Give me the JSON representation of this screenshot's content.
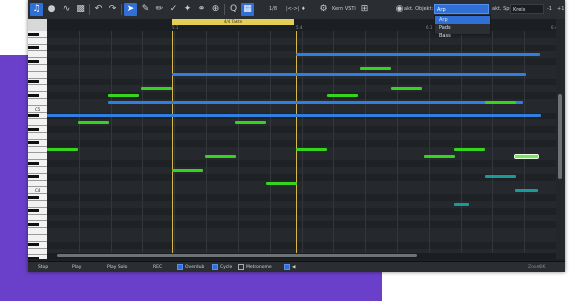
{
  "toolbar": {
    "quantize_value": "1/8",
    "ticks_label": "|<->| ♦",
    "instrument_label": "Kern VSTi",
    "object_label": "akt. Objekt:",
    "object_value": "Arp",
    "source_label": "akt. Spur:",
    "source_value": "Kreis",
    "minus_label": "-1",
    "plus_label": "+1"
  },
  "dropdown": {
    "items": [
      "Arp",
      "Pads",
      "Bass"
    ]
  },
  "ruler": {
    "region_label": "4/4 Takte",
    "markers": [
      {
        "label": "5.1",
        "pos": 0.245
      },
      {
        "label": "5.4",
        "pos": 0.49
      },
      {
        "label": "6.1",
        "pos": 0.745
      },
      {
        "label": "6.4",
        "pos": 0.99
      }
    ]
  },
  "piano": {
    "octave_labels": [
      "C5",
      "C4",
      "C3"
    ]
  },
  "notes": [
    {
      "start": 0.49,
      "length": 0.48,
      "row": 3,
      "color": "#2f7fe0"
    },
    {
      "start": 0.615,
      "length": 0.06,
      "row": 5,
      "color": "#34d41f"
    },
    {
      "start": 0.245,
      "length": 0.695,
      "row": 6,
      "color": "#2f7fe0"
    },
    {
      "start": 0.185,
      "length": 0.06,
      "row": 8,
      "color": "#34d41f"
    },
    {
      "start": 0.675,
      "length": 0.06,
      "row": 8,
      "color": "#34d41f"
    },
    {
      "start": 0.12,
      "length": 0.06,
      "row": 9,
      "color": "#34d41f"
    },
    {
      "start": 0.55,
      "length": 0.06,
      "row": 9,
      "color": "#34d41f"
    },
    {
      "start": 0.12,
      "length": 0.815,
      "row": 10,
      "color": "#2f7fe0"
    },
    {
      "start": 0.86,
      "length": 0.06,
      "row": 10,
      "color": "#34d41f"
    },
    {
      "start": 0.0,
      "length": 0.97,
      "row": 12,
      "color": "#2f7fe0"
    },
    {
      "start": 0.06,
      "length": 0.06,
      "row": 13,
      "color": "#34d41f"
    },
    {
      "start": 0.37,
      "length": 0.06,
      "row": 13,
      "color": "#34d41f"
    },
    {
      "start": 0.0,
      "length": 0.06,
      "row": 17,
      "color": "#34d41f"
    },
    {
      "start": 0.49,
      "length": 0.06,
      "row": 17,
      "color": "#34d41f"
    },
    {
      "start": 0.8,
      "length": 0.06,
      "row": 17,
      "color": "#34d41f"
    },
    {
      "start": 0.31,
      "length": 0.06,
      "row": 18,
      "color": "#34d41f"
    },
    {
      "start": 0.74,
      "length": 0.06,
      "row": 18,
      "color": "#34d41f"
    },
    {
      "start": 0.92,
      "length": 0.045,
      "row": 18,
      "color": "#7be36a"
    },
    {
      "start": 0.245,
      "length": 0.06,
      "row": 20,
      "color": "#34d41f"
    },
    {
      "start": 0.86,
      "length": 0.06,
      "row": 21,
      "color": "#1a9b9b"
    },
    {
      "start": 0.43,
      "length": 0.06,
      "row": 22,
      "color": "#34d41f"
    },
    {
      "start": 0.92,
      "length": 0.045,
      "row": 23,
      "color": "#1a9b9b"
    },
    {
      "start": 0.8,
      "length": 0.03,
      "row": 25,
      "color": "#1a9b9b"
    },
    {
      "start": 0.12,
      "length": 0.03,
      "row": 33,
      "color": "#1a9b9b"
    },
    {
      "start": 0.31,
      "length": 0.045,
      "row": 33,
      "color": "#1a9b9b"
    },
    {
      "start": 0.49,
      "length": 0.165,
      "row": 33,
      "color": "#1a9b9b"
    },
    {
      "start": 0.74,
      "length": 0.03,
      "row": 33,
      "color": "#1a9b9b"
    }
  ],
  "statusbar": {
    "stop_label": "Stop",
    "play_label": "Play",
    "playsolo_label": "Play Solo",
    "rec_label": "REC",
    "overdub_label": "Overdub",
    "cycle_label": "Cycle",
    "metronome_label": "Metronome",
    "zoom_label": "Zoom",
    "ok_label": "OK"
  },
  "colors": {
    "accent": "#2f6fd6",
    "note_blue": "#2f7fe0",
    "note_green": "#34d41f",
    "note_teal": "#1a9b9b",
    "playhead": "#d6b84a",
    "brand_purple": "#6a3fc9"
  }
}
